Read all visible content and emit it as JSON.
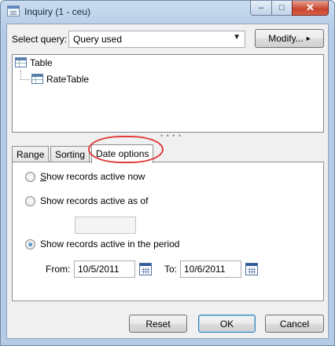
{
  "window": {
    "title": "Inquiry (1 - ceu)",
    "minimize_glyph": "–",
    "maximize_glyph": "□",
    "close_glyph": "✕"
  },
  "query": {
    "label": "Select query:",
    "value": "Query used",
    "dropdown_glyph": "▼",
    "modify_label": "Modify...",
    "modify_arrow": "▸"
  },
  "tree": {
    "root": "Table",
    "child": "RateTable"
  },
  "splitter": "• • • •",
  "tabs": [
    "Range",
    "Sorting",
    "Date options"
  ],
  "date_options": {
    "active_now": "Show records active now",
    "active_as_of": "Show records active as of",
    "as_of_value": "",
    "active_period": "Show records active in the period",
    "selected": "active_period",
    "from_label": "From:",
    "from_value": "10/5/2011",
    "to_label": "To:",
    "to_value": "10/6/2011"
  },
  "buttons": {
    "reset": "Reset",
    "ok": "OK",
    "cancel": "Cancel"
  },
  "colors": {
    "highlight_ring": "#e03a3a",
    "close_button": "#c8452f",
    "title_bar": "#c9dcf0"
  }
}
